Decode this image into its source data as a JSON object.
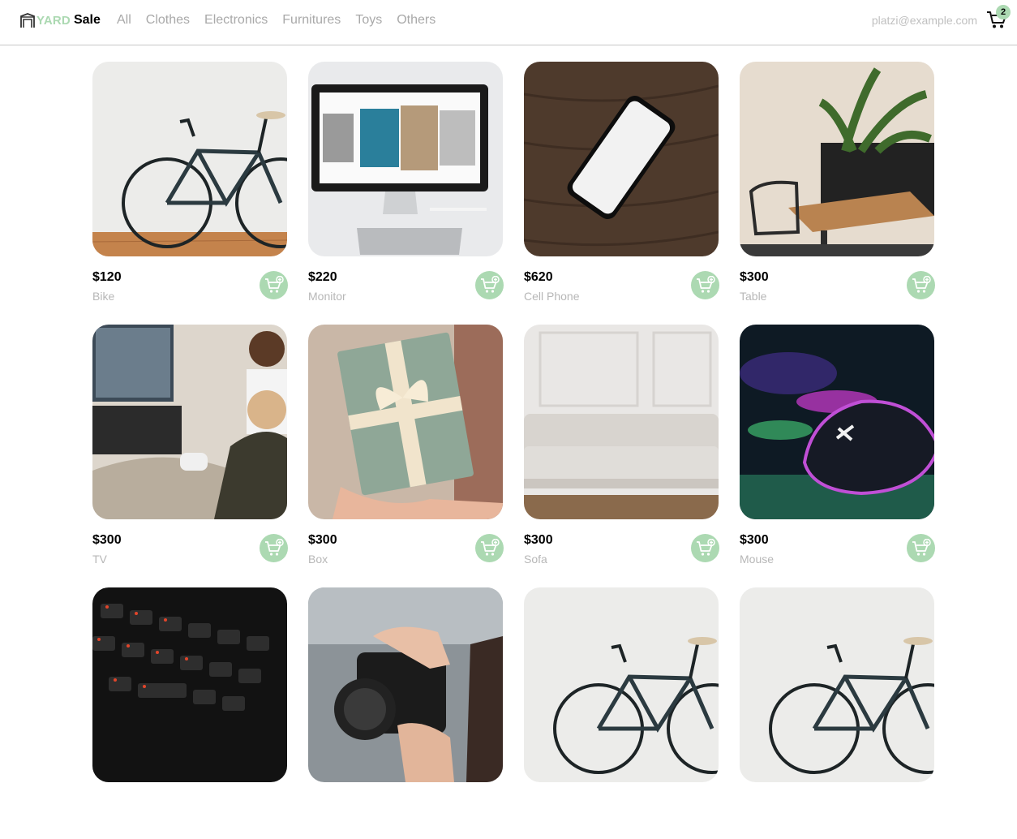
{
  "navbar": {
    "logo": {
      "part1": "YARD",
      "part2": "Sale"
    },
    "categories": [
      "All",
      "Clothes",
      "Electronics",
      "Furnitures",
      "Toys",
      "Others"
    ],
    "user_email": "platzi@example.com",
    "cart_count": "2"
  },
  "products": [
    {
      "price": "$120",
      "name": "Bike"
    },
    {
      "price": "$220",
      "name": "Monitor"
    },
    {
      "price": "$620",
      "name": "Cell Phone"
    },
    {
      "price": "$300",
      "name": "Table"
    },
    {
      "price": "$300",
      "name": "TV"
    },
    {
      "price": "$300",
      "name": "Box"
    },
    {
      "price": "$300",
      "name": "Sofa"
    },
    {
      "price": "$300",
      "name": "Mouse"
    },
    {
      "price": "",
      "name": ""
    },
    {
      "price": "",
      "name": ""
    },
    {
      "price": "",
      "name": ""
    },
    {
      "price": "",
      "name": ""
    }
  ],
  "colors": {
    "accent": "#acd9b2",
    "muted_text": "#b7b7b7",
    "nav_text": "#a9a9a9"
  }
}
